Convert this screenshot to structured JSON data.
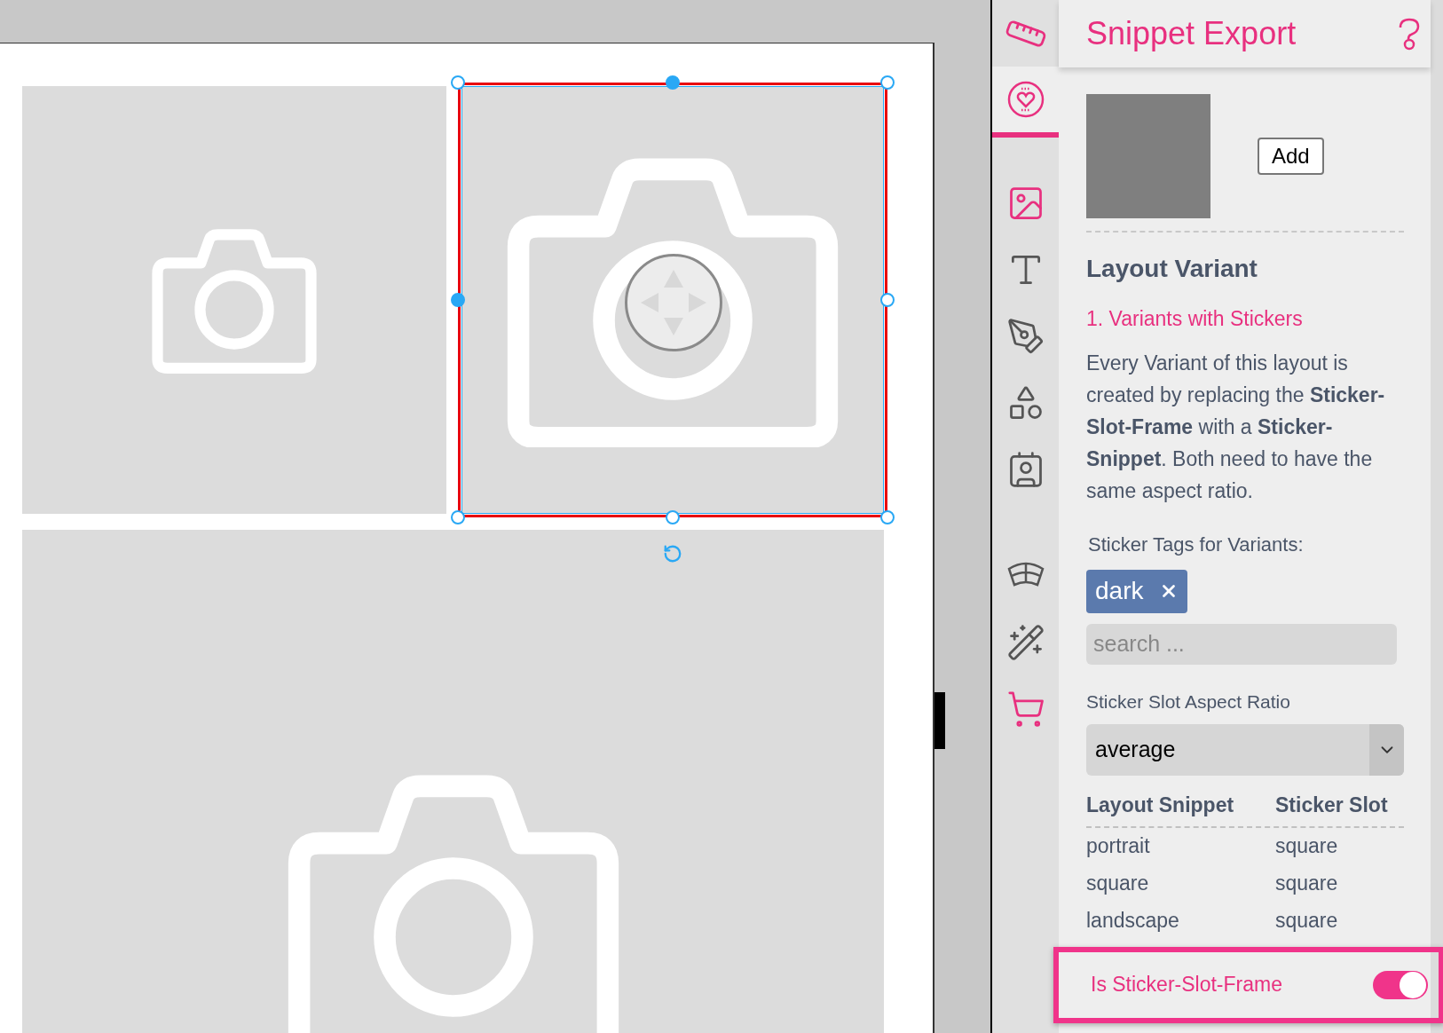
{
  "canvas": {
    "slots": [
      {
        "kind": "picture",
        "selected": false
      },
      {
        "kind": "picture",
        "selected": true
      },
      {
        "kind": "picture",
        "selected": false
      }
    ]
  },
  "toolbar": {
    "items": [
      {
        "kind": "ruler",
        "selected": false,
        "color": "#e8307f"
      },
      {
        "kind": "sticker",
        "selected": true,
        "color": "#e8307f"
      },
      {
        "kind": "image",
        "selected": false,
        "color": "#e8307f"
      },
      {
        "kind": "text",
        "selected": false,
        "color": "#555555"
      },
      {
        "kind": "path",
        "selected": false,
        "color": "#555555"
      },
      {
        "kind": "shapes",
        "selected": false,
        "color": "#555555"
      },
      {
        "kind": "contact",
        "selected": false,
        "color": "#555555"
      },
      {
        "kind": "grid",
        "selected": false,
        "color": "#555555"
      },
      {
        "kind": "wand",
        "selected": false,
        "color": "#555555"
      },
      {
        "kind": "cart",
        "selected": false,
        "color": "#e8307f"
      }
    ]
  },
  "panel": {
    "title": "Snippet Export",
    "add_button": "Add",
    "section_title": "Layout Variant",
    "subtitle": "1. Variants with Stickers",
    "description": "Every Variant of this layout is created by replacing the **Sticker-Slot-Frame** with a **Sticker-Snippet**. Both need to have the same aspect ratio.",
    "tags_label": "Sticker Tags for Variants:",
    "tags": [
      {
        "label": "dark"
      }
    ],
    "search": {
      "placeholder": "search ..."
    },
    "aspect_label": "Sticker Slot Aspect Ratio",
    "aspect_select": {
      "value": "average"
    },
    "table": {
      "columns": [
        "Layout Snippet",
        "Sticker Slot"
      ],
      "rows": [
        [
          "portrait",
          "square"
        ],
        [
          "square",
          "square"
        ],
        [
          "landscape",
          "square"
        ]
      ]
    },
    "toggle": {
      "label": "Is Sticker-Slot-Frame",
      "on": true,
      "highlighted": true
    }
  }
}
